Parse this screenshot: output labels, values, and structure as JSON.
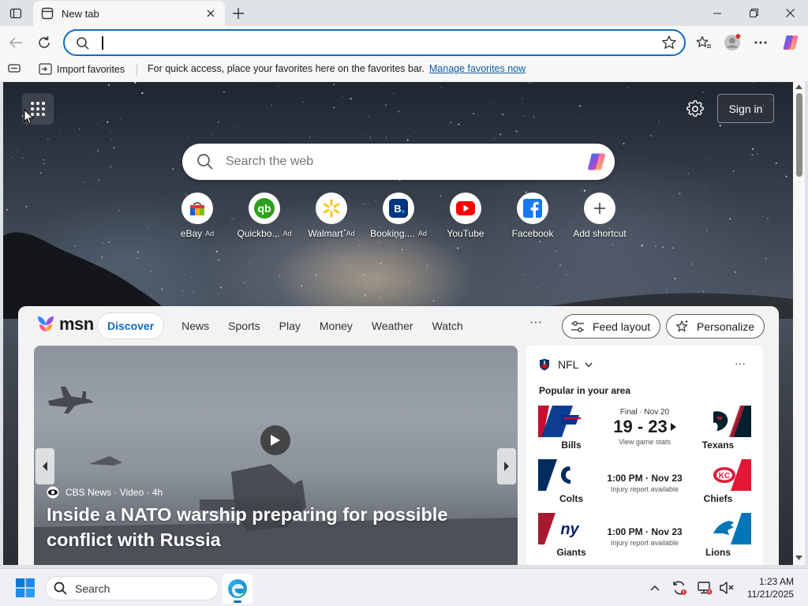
{
  "browser": {
    "tab": {
      "title": "New tab"
    },
    "address_bar": {
      "value": "",
      "placeholder": ""
    },
    "favorites_bar": {
      "import_label": "Import favorites",
      "message": "For quick access, place your favorites here on the favorites bar.",
      "manage_link": "Manage favorites now"
    }
  },
  "newtab": {
    "signin_label": "Sign in",
    "search_placeholder": "Search the web",
    "ad_label": "Ad",
    "shortcuts": [
      {
        "label": "eBay",
        "ad": true,
        "icon": "ebay-bag-icon"
      },
      {
        "label": "Quickbo...",
        "ad": true,
        "icon": "quickbooks-icon",
        "color": "#2ca01c"
      },
      {
        "label": "Walmart",
        "ad": true,
        "icon": "walmart-spark-icon",
        "color": "#0071ce"
      },
      {
        "label": "Booking....",
        "ad": true,
        "icon": "booking-icon",
        "color": "#003580"
      },
      {
        "label": "YouTube",
        "ad": false,
        "icon": "youtube-icon",
        "color": "#ff0000"
      },
      {
        "label": "Facebook",
        "ad": false,
        "icon": "facebook-icon",
        "color": "#1877f2"
      },
      {
        "label": "Add shortcut",
        "ad": false,
        "icon": "plus-icon"
      }
    ]
  },
  "feed": {
    "brand": "msn",
    "tabs": [
      "Discover",
      "News",
      "Sports",
      "Play",
      "Money",
      "Weather",
      "Watch"
    ],
    "active_tab": "Discover",
    "more_label": "···",
    "feed_layout_label": "Feed layout",
    "personalize_label": "Personalize",
    "hero": {
      "source": "CBS News · Video · 4h",
      "headline": "Inside a NATO warship preparing for possible conflict with Russia"
    },
    "nfl": {
      "title": "NFL",
      "more_label": "···",
      "subtitle": "Popular in your area",
      "games": [
        {
          "home": "Bills",
          "away": "Texans",
          "status": "Final · Nov 20",
          "score": "19 - 23",
          "note": "View game stats",
          "home_color": "#00338d",
          "away_color": "#03202f"
        },
        {
          "home": "Colts",
          "away": "Chiefs",
          "status": "1:00 PM · Nov 23",
          "note": "Injury report available",
          "home_color": "#002c5f",
          "away_color": "#e31837"
        },
        {
          "home": "Giants",
          "away": "Lions",
          "status": "1:00 PM · Nov 23",
          "note": "Injury report available",
          "home_color": "#0b2265",
          "away_color": "#0076b6"
        }
      ]
    }
  },
  "taskbar": {
    "search_label": "Search",
    "time": "1:23 AM",
    "date": "11/21/2025"
  },
  "colors": {
    "accent": "#0f6cbd",
    "titlebar_bg": "#dfe3e8",
    "toolbar_bg": "#f7f7f7"
  }
}
